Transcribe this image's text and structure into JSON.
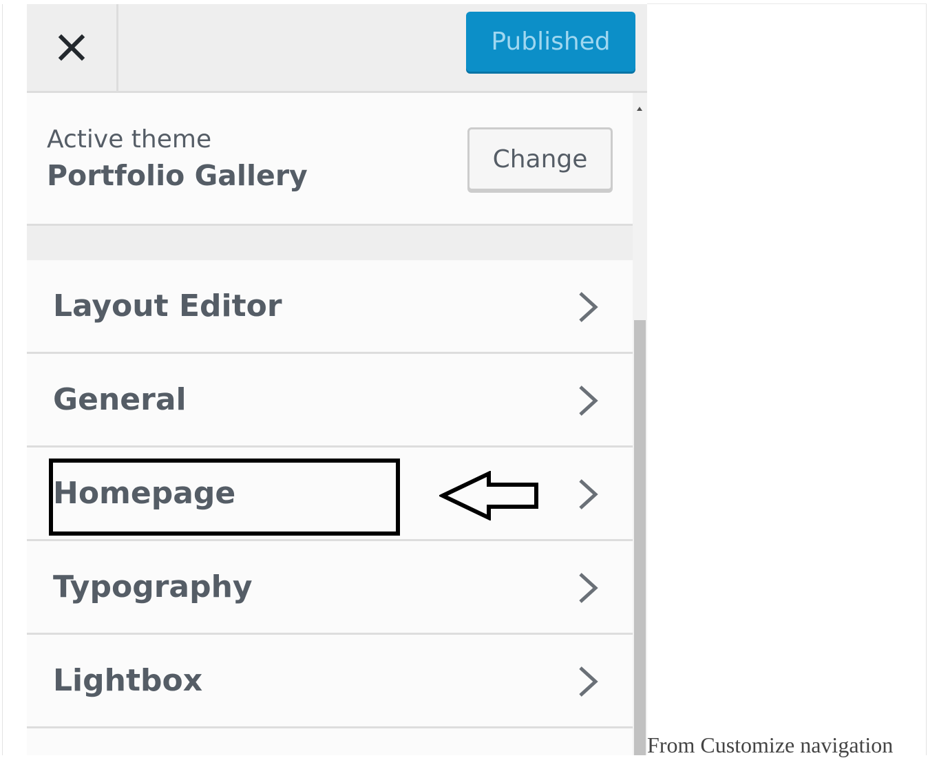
{
  "header": {
    "close_icon": "close-icon",
    "publish_label": "Published",
    "publish_color": "#0c8fc8"
  },
  "theme": {
    "label": "Active theme",
    "name": "Portfolio Gallery",
    "change_label": "Change"
  },
  "menu": {
    "items": [
      {
        "label": "Layout Editor"
      },
      {
        "label": "General"
      },
      {
        "label": "Homepage"
      },
      {
        "label": "Typography"
      },
      {
        "label": "Lightbox"
      }
    ],
    "chevron_icon": "chevron-right-icon"
  },
  "annotation": {
    "highlight_target": "Homepage",
    "arrow_icon": "left-arrow-icon"
  },
  "caption": "From Customize navigation"
}
